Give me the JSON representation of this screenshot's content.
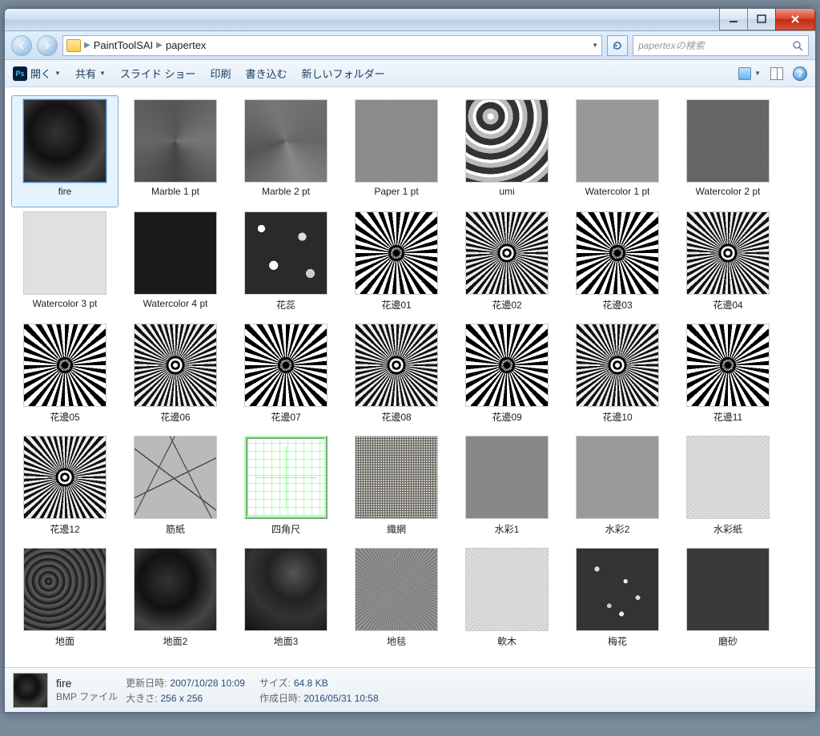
{
  "breadcrumb": {
    "part1": "PaintToolSAI",
    "part2": "papertex"
  },
  "search": {
    "placeholder": "papertexの検索"
  },
  "toolbar": {
    "open": "開く",
    "share": "共有",
    "slideshow": "スライド ショー",
    "print": "印刷",
    "burn": "書き込む",
    "newfolder": "新しいフォルダー"
  },
  "files": [
    {
      "name": "fire",
      "cls": "tx-dark",
      "selected": true
    },
    {
      "name": "Marble 1 pt",
      "cls": "tx-marble1"
    },
    {
      "name": "Marble 2 pt",
      "cls": "tx-marble2"
    },
    {
      "name": "Paper 1 pt",
      "cls": "tx-paper"
    },
    {
      "name": "umi",
      "cls": "tx-umi"
    },
    {
      "name": "Watercolor 1 pt",
      "cls": "tx-wc1"
    },
    {
      "name": "Watercolor 2 pt",
      "cls": "tx-wc2"
    },
    {
      "name": "Watercolor 3 pt",
      "cls": "tx-wc3"
    },
    {
      "name": "Watercolor 4 pt",
      "cls": "tx-wc4"
    },
    {
      "name": "花蕊",
      "cls": "tx-flower"
    },
    {
      "name": "花邊01",
      "cls": "tx-lace"
    },
    {
      "name": "花邊02",
      "cls": "tx-lace2"
    },
    {
      "name": "花邊03",
      "cls": "tx-lace"
    },
    {
      "name": "花邊04",
      "cls": "tx-lace2"
    },
    {
      "name": "花邊05",
      "cls": "tx-lace"
    },
    {
      "name": "花邊06",
      "cls": "tx-lace2"
    },
    {
      "name": "花邊07",
      "cls": "tx-lace"
    },
    {
      "name": "花邊08",
      "cls": "tx-lace2"
    },
    {
      "name": "花邊09",
      "cls": "tx-lace"
    },
    {
      "name": "花邊10",
      "cls": "tx-lace2"
    },
    {
      "name": "花邊11",
      "cls": "tx-lace"
    },
    {
      "name": "花邊12",
      "cls": "tx-lace2"
    },
    {
      "name": "筋紙",
      "cls": "tx-crack"
    },
    {
      "name": "四角尺",
      "cls": "tx-geo"
    },
    {
      "name": "織網",
      "cls": "tx-weave"
    },
    {
      "name": "水彩1",
      "cls": "tx-flat1"
    },
    {
      "name": "水彩2",
      "cls": "tx-flat2"
    },
    {
      "name": "水彩紙",
      "cls": "tx-noise-lt"
    },
    {
      "name": "地面",
      "cls": "tx-grainy"
    },
    {
      "name": "地面2",
      "cls": "tx-dark"
    },
    {
      "name": "地面3",
      "cls": "tx-dark2"
    },
    {
      "name": "地毯",
      "cls": "tx-noise"
    },
    {
      "name": "軟木",
      "cls": "tx-noise-lt"
    },
    {
      "name": "梅花",
      "cls": "tx-plum"
    },
    {
      "name": "磨砂",
      "cls": "tx-sand"
    }
  ],
  "details": {
    "name": "fire",
    "type": "BMP ファイル",
    "modified_lbl": "更新日時:",
    "modified_val": "2007/10/28 10:09",
    "dim_lbl": "大きさ:",
    "dim_val": "256 x 256",
    "size_lbl": "サイズ:",
    "size_val": "64.8 KB",
    "created_lbl": "作成日時:",
    "created_val": "2016/05/31 10:58"
  }
}
